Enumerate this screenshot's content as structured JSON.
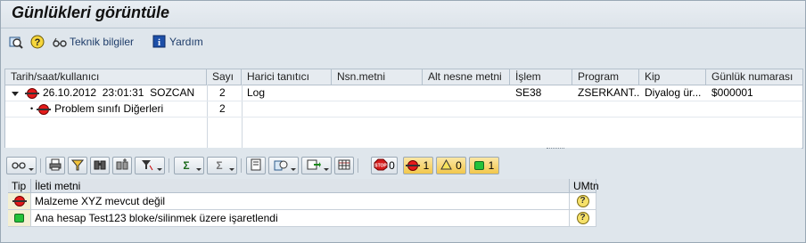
{
  "window": {
    "title": "Günlükleri görüntüle"
  },
  "app_toolbar": {
    "items": [
      {
        "icon": "find-icon",
        "label": ""
      },
      {
        "icon": "help-icon",
        "label": ""
      },
      {
        "icon": "glasses-icon",
        "label": "Teknik bilgiler"
      },
      {
        "icon": "info-icon",
        "label": "Yardım"
      }
    ]
  },
  "log_tree": {
    "columns": [
      "Tarih/saat/kullanıcı",
      "Sayı",
      "Harici tanıtıcı",
      "Nsn.metni",
      "Alt nesne metni",
      "İşlem",
      "Program",
      "Kip",
      "Günlük numarası"
    ],
    "rows": [
      {
        "tree": "26.10.2012  23:01:31  SOZCAN",
        "count": "2",
        "ext_id": "Log",
        "obj_text": "",
        "sub_obj_text": "",
        "tcode": "SE38",
        "program": "ZSERKANT...",
        "mode": "Diyalog ür...",
        "log_number": "$000001"
      },
      {
        "tree": "Problem sınıfı Diğerleri",
        "count": "2",
        "ext_id": "",
        "obj_text": "",
        "sub_obj_text": "",
        "tcode": "",
        "program": "",
        "mode": "",
        "log_number": ""
      }
    ]
  },
  "alv_toolbar": {
    "counters": {
      "stop": "0",
      "error": "1",
      "warning": "0",
      "success": "1"
    }
  },
  "message_grid": {
    "columns": [
      "Tip",
      "İleti metni",
      "UMtn"
    ],
    "rows": [
      {
        "type": "error",
        "text": "Malzeme XYZ mevcut değil",
        "help": "?"
      },
      {
        "type": "success",
        "text": "Ana hesap Test123 bloke/silinmek üzere işaretlendi",
        "help": "?"
      }
    ]
  }
}
